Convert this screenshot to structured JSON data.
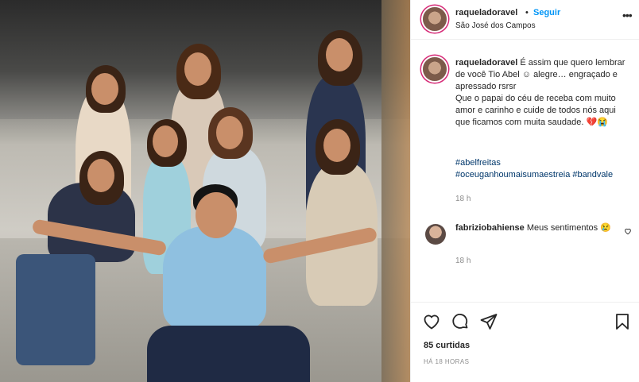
{
  "post": {
    "image_alt": "",
    "header": {
      "username": "raqueladoravel",
      "dot": "•",
      "follow_label": "Seguir",
      "location": "São José dos Campos",
      "more_icon": "more-options-icon"
    },
    "caption": {
      "username": "raqueladoravel",
      "text": "É assim que quero lembrar de você Tio Abel ☺ alegre… engraçado e apressado rsrsr\nQue o papai do céu de receba com muito amor e carinho e cuide de todos nós aqui que ficamos com muita saudade. 💔😭",
      "hashtags": [
        "#abelfreitas",
        "#oceuganhoumaisumaestreia",
        "#bandvale"
      ],
      "time": "18 h"
    },
    "comments": [
      {
        "username": "fabriziobahiense",
        "text": "Meus sentimentos 😢",
        "time": "18 h"
      }
    ],
    "actions": {
      "like_icon": "heart-icon",
      "comment_icon": "comment-icon",
      "share_icon": "share-icon",
      "save_icon": "bookmark-icon"
    },
    "likes": "85 curtidas",
    "posted_ago": "HÁ 18 HORAS"
  },
  "colors": {
    "accent": "#0095f6",
    "hashtag": "#00376b",
    "muted": "#8e8e8e",
    "story_ring": "#d62976"
  }
}
